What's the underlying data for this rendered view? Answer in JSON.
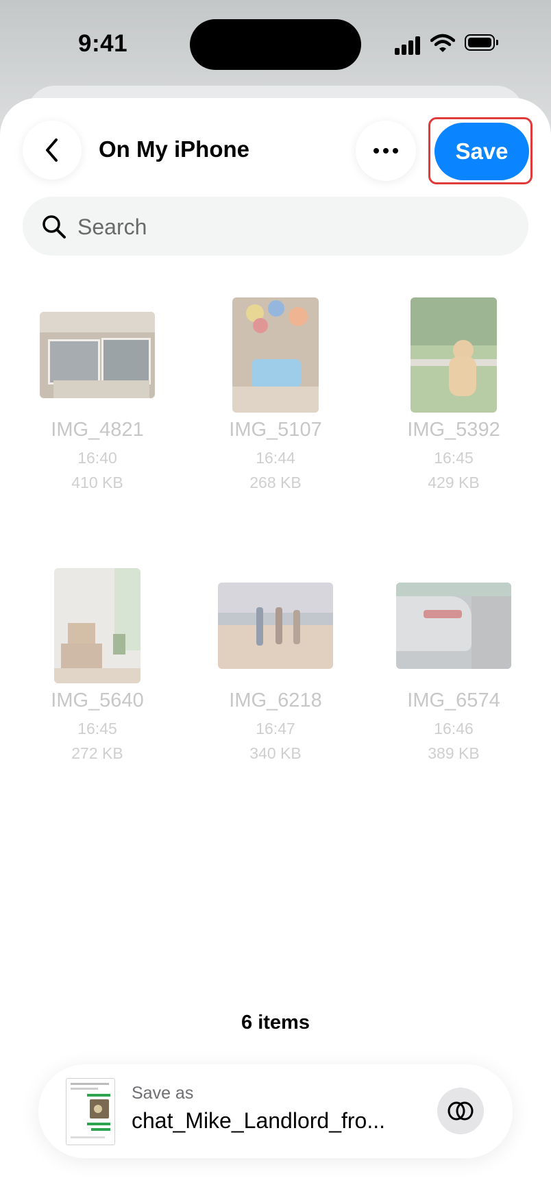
{
  "status_bar": {
    "time": "9:41"
  },
  "header": {
    "title": "On My iPhone",
    "back_icon": "chevron-left-icon",
    "more_icon": "ellipsis-icon",
    "save_label": "Save",
    "accent_color": "#0a84ff"
  },
  "search": {
    "placeholder": "Search",
    "icon": "search-icon"
  },
  "files": [
    {
      "name": "IMG_4821",
      "time": "16:40",
      "size": "410 KB"
    },
    {
      "name": "IMG_5107",
      "time": "16:44",
      "size": "268 KB"
    },
    {
      "name": "IMG_5392",
      "time": "16:45",
      "size": "429 KB"
    },
    {
      "name": "IMG_5640",
      "time": "16:45",
      "size": "272 KB"
    },
    {
      "name": "IMG_6218",
      "time": "16:47",
      "size": "340 KB"
    },
    {
      "name": "IMG_6574",
      "time": "16:46",
      "size": "389 KB"
    }
  ],
  "footer": {
    "item_count": "6 items"
  },
  "save_as": {
    "label": "Save as",
    "filename": "chat_Mike_Landlord_fro...",
    "toggle_icon": "overlap-circles-icon"
  },
  "highlight_color": "#e03a3a"
}
